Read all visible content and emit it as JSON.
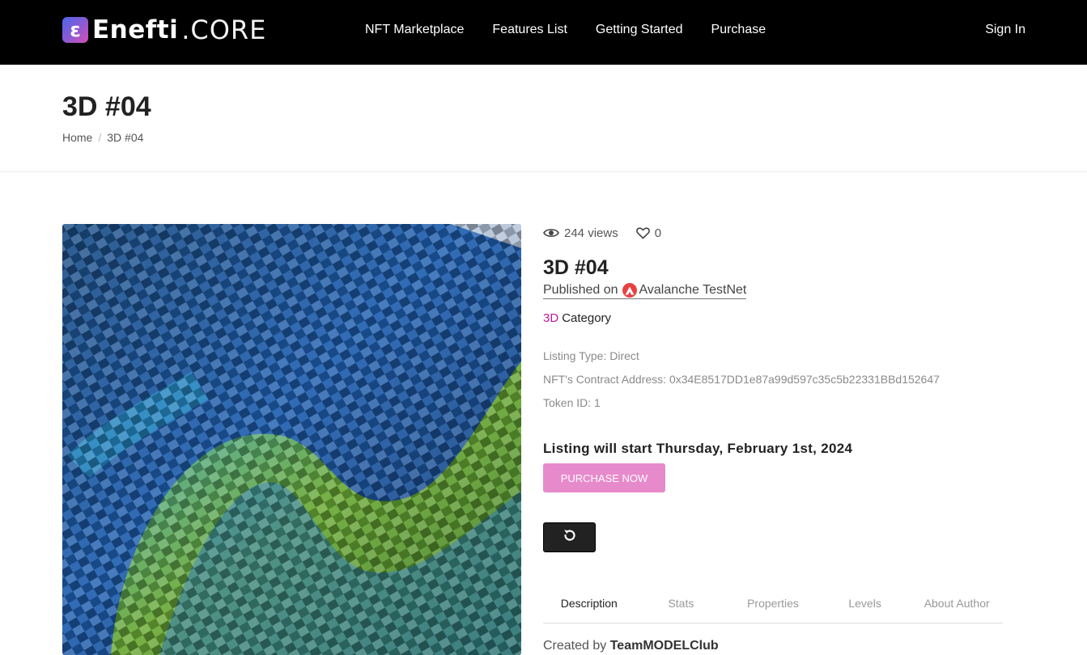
{
  "header": {
    "logo_mark": "ε",
    "logo_name": "Enefti",
    "logo_suffix": ".CORE",
    "nav": [
      "NFT Marketplace",
      "Features List",
      "Getting Started",
      "Purchase"
    ],
    "sign_in": "Sign In"
  },
  "page": {
    "title": "3D #04",
    "breadcrumb": {
      "home": "Home",
      "separator": "/",
      "current": "3D #04"
    }
  },
  "nft": {
    "views": "244 views",
    "likes": "0",
    "title": "3D #04",
    "published_prefix": "Published on",
    "network": "Avalanche TestNet",
    "category_name": "3D",
    "category_label": "Category",
    "listing_type": "Listing Type: Direct",
    "contract_address": "NFT's Contract Address: 0x34E8517DD1e87a99d597c35c5b22331BBd152647",
    "token_id": "Token ID: 1",
    "listing_start": "Listing will start Thursday, February 1st, 2024",
    "purchase_button": "PURCHASE NOW"
  },
  "tabs": [
    "Description",
    "Stats",
    "Properties",
    "Levels",
    "About Author"
  ],
  "active_tab": "Description",
  "created": {
    "prefix": "Created by",
    "author": "TeamMODELClub"
  },
  "colors": {
    "accent": "#c0199c",
    "purchase_button": "#e78acb",
    "avalanche": "#e84142",
    "header_bg": "#000000"
  },
  "icons": [
    "eye-icon",
    "heart-icon",
    "avalanche-icon",
    "refresh-icon"
  ]
}
